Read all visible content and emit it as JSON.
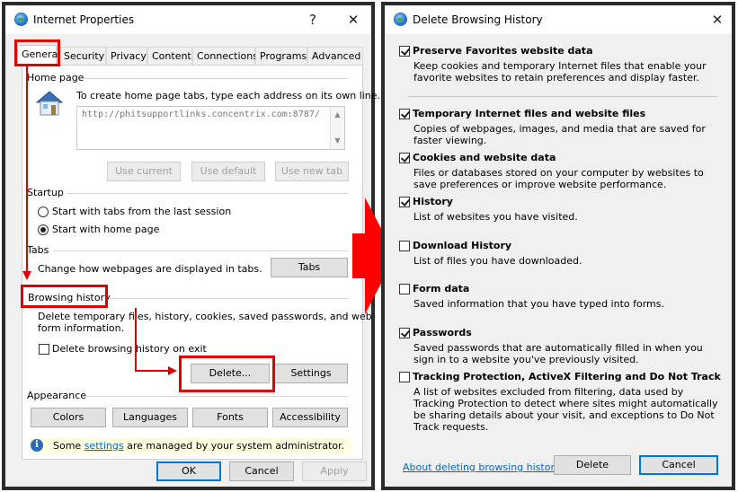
{
  "left_window": {
    "title": "Internet Properties",
    "help_glyph": "?",
    "close_glyph": "✕",
    "tabs": [
      {
        "label": "General",
        "active": true
      },
      {
        "label": "Security",
        "active": false
      },
      {
        "label": "Privacy",
        "active": false
      },
      {
        "label": "Content",
        "active": false
      },
      {
        "label": "Connections",
        "active": false
      },
      {
        "label": "Programs",
        "active": false
      },
      {
        "label": "Advanced",
        "active": false
      }
    ],
    "home_page": {
      "label": "Home page",
      "instruction": "To create home page tabs, type each address on its own line.",
      "url": "http://phitsupportlinks.concentrix.com:8787/",
      "buttons": {
        "use_current": "Use current",
        "use_default": "Use default",
        "use_new_tab": "Use new tab"
      }
    },
    "startup": {
      "label": "Startup",
      "option_last_session": "Start with tabs from the last session",
      "option_home_page": "Start with home page",
      "selected": "home_page"
    },
    "tabs_group": {
      "label": "Tabs",
      "description": "Change how webpages are displayed in tabs.",
      "button": "Tabs"
    },
    "browsing_history": {
      "label": "Browsing history",
      "description_line1": "Delete temporary files, history, cookies, saved passwords, and web",
      "description_line2": "form information.",
      "delete_on_exit_label": "Delete browsing history on exit",
      "delete_on_exit_checked": false,
      "delete_button": "Delete...",
      "settings_button": "Settings"
    },
    "appearance": {
      "label": "Appearance",
      "buttons": {
        "colors": "Colors",
        "languages": "Languages",
        "fonts": "Fonts",
        "accessibility": "Accessibility"
      }
    },
    "info": {
      "prefix": "Some ",
      "link": "settings",
      "suffix": " are managed by your system administrator."
    },
    "footer": {
      "ok": "OK",
      "cancel": "Cancel",
      "apply": "Apply"
    }
  },
  "right_window": {
    "title": "Delete Browsing History",
    "close_glyph": "✕",
    "options": [
      {
        "key": "preserve",
        "title": "Preserve Favorites website data",
        "desc": "Keep cookies and temporary Internet files that enable your favorite websites to retain preferences and display faster.",
        "checked": true
      },
      {
        "key": "temp",
        "title": "Temporary Internet files and website files",
        "desc": "Copies of webpages, images, and media that are saved for faster viewing.",
        "checked": true
      },
      {
        "key": "cookies",
        "title": "Cookies and website data",
        "desc": "Files or databases stored on your computer by websites to save preferences or improve website performance.",
        "checked": true
      },
      {
        "key": "history",
        "title": "History",
        "desc": "List of websites you have visited.",
        "checked": true
      },
      {
        "key": "download",
        "title": "Download History",
        "desc": "List of files you have downloaded.",
        "checked": false
      },
      {
        "key": "form",
        "title": "Form data",
        "desc": "Saved information that you have typed into forms.",
        "checked": false
      },
      {
        "key": "passwords",
        "title": "Passwords",
        "desc": "Saved passwords that are automatically filled in when you sign in to a website you've previously visited.",
        "checked": true
      },
      {
        "key": "tracking",
        "title": "Tracking Protection, ActiveX Filtering and Do Not Track",
        "desc": "A list of websites excluded from filtering, data used by Tracking Protection to detect where sites might automatically be sharing details about your visit, and exceptions to Do Not Track requests.",
        "checked": false
      }
    ],
    "about_link": "About deleting browsing history",
    "delete_button": "Delete",
    "cancel_button": "Cancel"
  },
  "colors": {
    "annotation_red": "#e00000",
    "link_blue": "#0066cc",
    "info_yellow": "#ffffe1"
  }
}
